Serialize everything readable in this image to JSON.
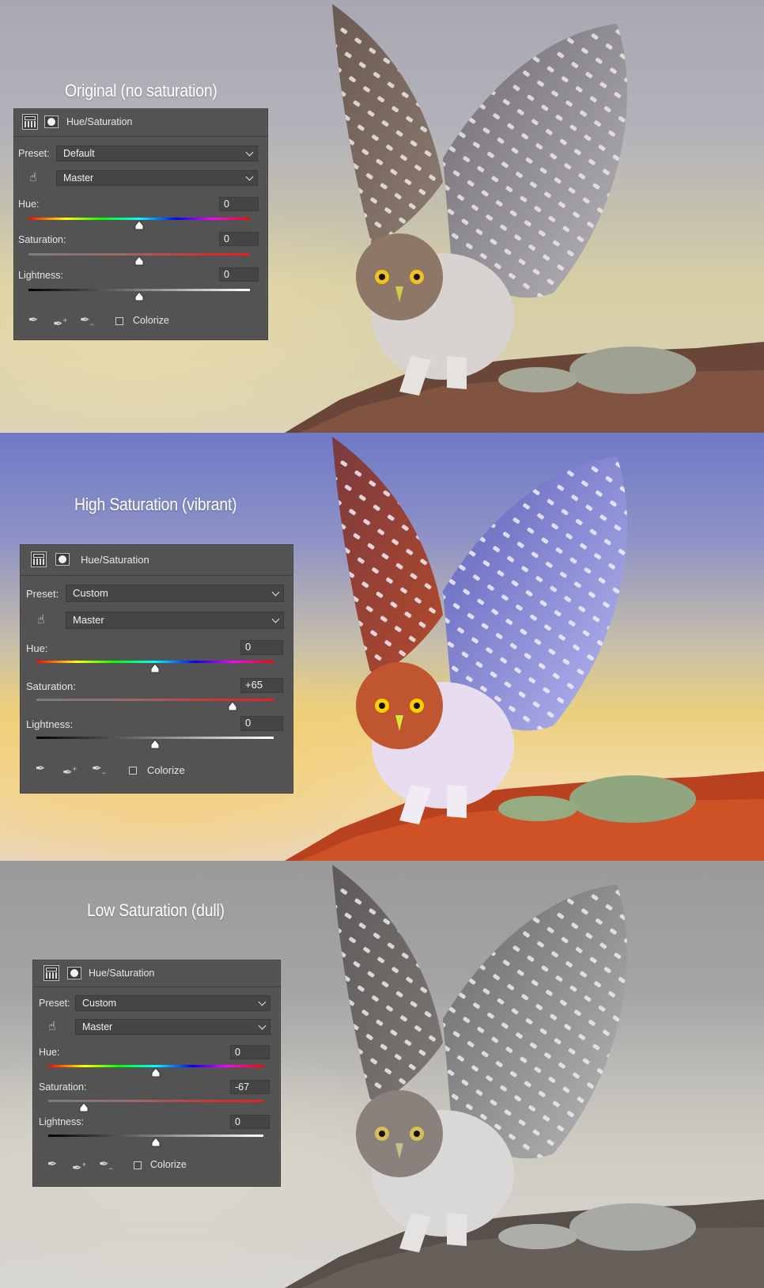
{
  "panels": [
    {
      "caption": "Original (no saturation)",
      "title": "Hue/Saturation",
      "preset_label": "Preset:",
      "preset_value": "Default",
      "channel_value": "Master",
      "hue_label": "Hue:",
      "hue_value": "0",
      "hue_level": 0,
      "saturation_label": "Saturation:",
      "saturation_value": "0",
      "saturation_level": 0,
      "lightness_label": "Lightness:",
      "lightness_value": "0",
      "lightness_level": 0,
      "colorize_label": "Colorize"
    },
    {
      "caption": "High Saturation (vibrant)",
      "title": "Hue/Saturation",
      "preset_label": "Preset:",
      "preset_value": "Custom",
      "channel_value": "Master",
      "hue_label": "Hue:",
      "hue_value": "0",
      "hue_level": 0,
      "saturation_label": "Saturation:",
      "saturation_value": "+65",
      "saturation_level": 65,
      "lightness_label": "Lightness:",
      "lightness_value": "0",
      "lightness_level": 0,
      "colorize_label": "Colorize"
    },
    {
      "caption": "Low Saturation (dull)",
      "title": "Hue/Saturation",
      "preset_label": "Preset:",
      "preset_value": "Custom",
      "channel_value": "Master",
      "hue_label": "Hue:",
      "hue_value": "0",
      "hue_level": 0,
      "saturation_label": "Saturation:",
      "saturation_value": "-67",
      "saturation_level": -67,
      "lightness_label": "Lightness:",
      "lightness_value": "0",
      "lightness_level": 0,
      "colorize_label": "Colorize"
    }
  ],
  "icons": [
    "adjustment-layer-icon",
    "mask-icon",
    "targeted-adjustment-hand-icon",
    "eyedropper-icon",
    "eyedropper-add-icon",
    "eyedropper-subtract-icon",
    "chevron-down-icon",
    "slider-thumb-icon"
  ],
  "colors": {
    "panel_bg": "#535353",
    "field_bg": "#454545",
    "text": "#e6e6e6",
    "caption": "#ffffff"
  }
}
